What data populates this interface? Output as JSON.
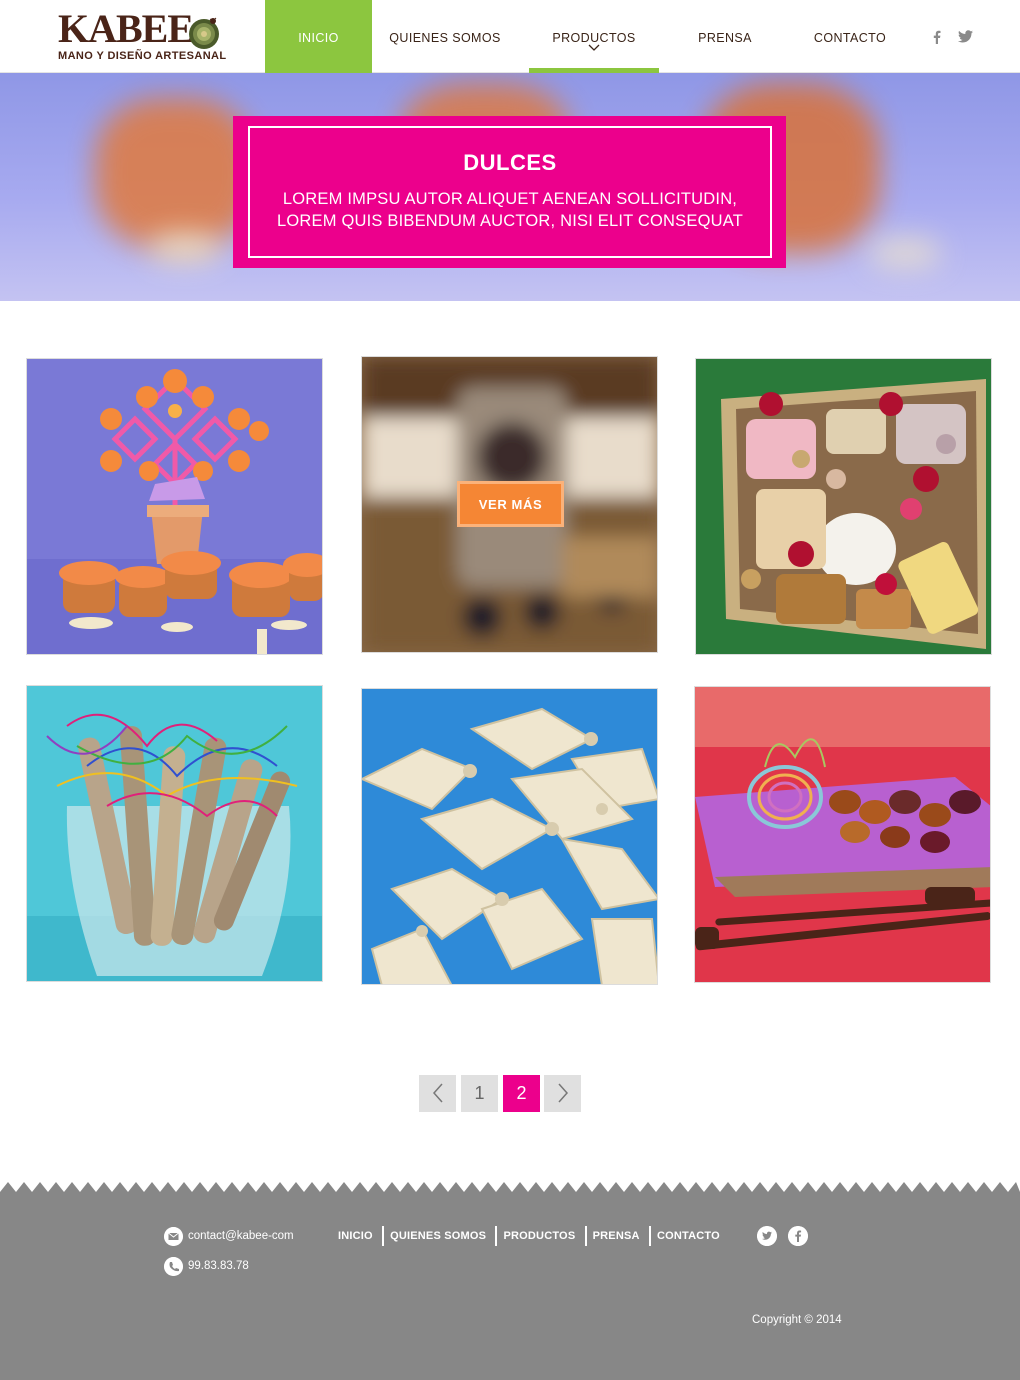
{
  "header": {
    "logo_word": "KABEE",
    "logo_tagline": "MANO Y DISEÑO ARTESANAL",
    "nav": [
      {
        "label": "INICIO"
      },
      {
        "label": "QUIENES SOMOS"
      },
      {
        "label": "PRODUCTOS"
      },
      {
        "label": "PRENSA"
      },
      {
        "label": "CONTACTO"
      }
    ],
    "social": {
      "facebook": "f",
      "twitter": "twitter-icon"
    }
  },
  "hero": {
    "title": "DULCES",
    "text_line1": "LOREM IMPSU AUTOR ALIQUET AENEAN SOLLICITUDIN,",
    "text_line2": "LOREM QUIS BIBENDUM AUCTOR, NISI ELIT CONSEQUAT"
  },
  "gallery": {
    "hover_button": "VER MÁS",
    "hover_button_color": "#f58634"
  },
  "pagination": {
    "prev": "‹",
    "pages": [
      "1",
      "2"
    ],
    "current": "2",
    "next": "›"
  },
  "footer": {
    "email": "contact@kabee-com",
    "phone": "99.83.83.78",
    "nav": [
      "INICIO",
      "QUIENES SOMOS",
      "PRODUCTOS",
      "PRENSA",
      "CONTACTO"
    ],
    "copyright": "Copyright © 2014"
  },
  "colors": {
    "accent_green": "#8cc63f",
    "accent_pink": "#ec008c",
    "footer_gray": "#878787",
    "brand_brown": "#4a2418"
  }
}
